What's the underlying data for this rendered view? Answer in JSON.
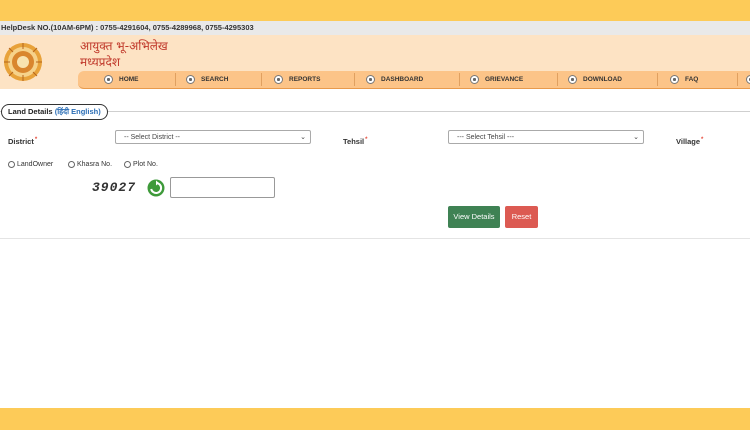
{
  "helpdesk": {
    "text": "HelpDesk NO.(10AM-6PM) : 0755-4291604, 0755-4289968, 0755-4295303"
  },
  "header": {
    "title_line1": "आयुक्त भू-अभिलेख",
    "title_line2": "मध्यप्रदेश"
  },
  "nav": {
    "items": [
      {
        "label": "HOME",
        "icon": "home-icon"
      },
      {
        "label": "SEARCH",
        "icon": "search-icon"
      },
      {
        "label": "REPORTS",
        "icon": "reports-icon"
      },
      {
        "label": "DASHBOARD",
        "icon": "dashboard-icon"
      },
      {
        "label": "GRIEVANCE",
        "icon": "grievance-icon"
      },
      {
        "label": "DOWNLOAD",
        "icon": "download-icon"
      },
      {
        "label": "FAQ",
        "icon": "faq-icon"
      }
    ]
  },
  "tab": {
    "label": "Land Details",
    "lang_hindi": "हिंदी",
    "lang_english": "English"
  },
  "form": {
    "district_label": "District",
    "district_placeholder": "-- Select District --",
    "tehsil_label": "Tehsil",
    "tehsil_placeholder": "--- Select Tehsil ---",
    "village_label": "Village",
    "required_mark": "*",
    "search_by": [
      "LandOwner",
      "Khasra No.",
      "Plot No."
    ],
    "captcha_code": "39027",
    "view_button": "View Details",
    "reset_button": "Reset"
  },
  "colors": {
    "band": "#fdcb58",
    "header_bg": "#fde3c4",
    "nav_bg": "#fcc488",
    "title": "#c0392b",
    "view_button": "#3f8254",
    "reset_button": "#dc5a52"
  }
}
